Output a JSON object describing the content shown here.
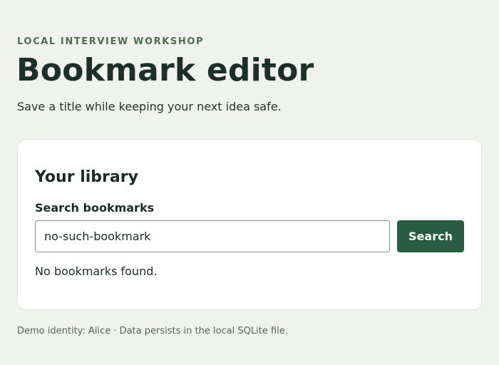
{
  "header": {
    "eyebrow": "LOCAL INTERVIEW WORKSHOP",
    "title": "Bookmark editor",
    "subtitle": "Save a title while keeping your next idea safe."
  },
  "library": {
    "heading": "Your library",
    "search_label": "Search bookmarks",
    "search_value": "no-such-bookmark",
    "search_button": "Search",
    "empty_message": "No bookmarks found."
  },
  "footer": {
    "text": "Demo identity: Alice · Data persists in the local SQLite file."
  },
  "colors": {
    "page_background": "#f0f2ed",
    "accent": "#285c44",
    "eyebrow": "#4f6b52"
  }
}
